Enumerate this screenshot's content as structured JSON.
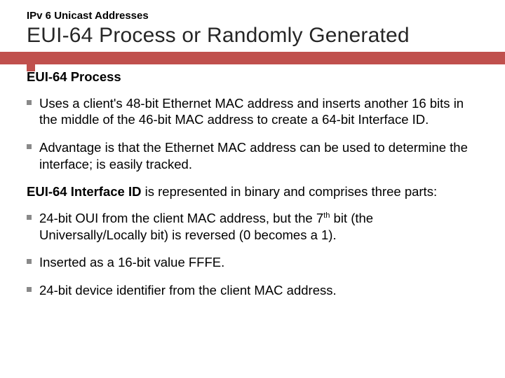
{
  "kicker": "IPv 6 Unicast Addresses",
  "title": "EUI-64 Process or Randomly Generated",
  "section1_head": "EUI-64 Process",
  "section1_bullets": [
    "Uses a client's 48-bit Ethernet MAC address and inserts another 16 bits in the middle of the 46-bit MAC address to create a 64-bit Interface ID.",
    "Advantage is that the Ethernet MAC address can be used to determine the interface; is easily tracked."
  ],
  "section2_intro_bold": "EUI-64 Interface ID",
  "section2_intro_rest": " is represented in binary and comprises three parts:",
  "section2_bullets_pre": [
    "24-bit OUI from the client MAC address, but the 7",
    "Inserted as a 16-bit value FFFE.",
    "24-bit device identifier from the client MAC address."
  ],
  "section2_bullet0_sup": "th",
  "section2_bullet0_post": " bit (the Universally/Locally bit) is reversed (0 becomes a 1)."
}
